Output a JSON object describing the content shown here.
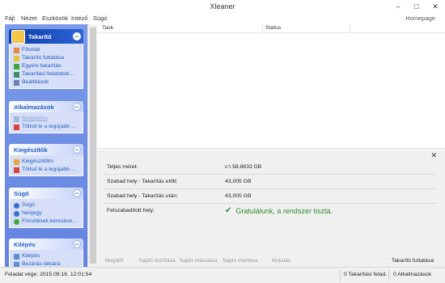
{
  "window": {
    "title": "Xleaner",
    "minimize": "–",
    "maximize": "□",
    "close": "✕"
  },
  "menu": {
    "items": [
      "Fájl",
      "Nézet",
      "Eszközök",
      "Intéző",
      "Súgó"
    ],
    "homepage": "Homepage"
  },
  "sidebar": {
    "takarito": {
      "title": "Takarító",
      "items": [
        "Főoldal",
        "Takarító futtatása",
        "Egyéni takarítás",
        "Takarítási feladatok...",
        "Beállítások"
      ]
    },
    "alkalmazasok": {
      "title": "Alkalmazások",
      "items": [
        "Beépülőim",
        "Töltsd le a legújabb ..."
      ]
    },
    "kiegeszitok": {
      "title": "Kiegészítők",
      "items": [
        "Kiegészítőim",
        "Töltsd le a legújabb ..."
      ]
    },
    "sugo": {
      "title": "Súgó",
      "items": [
        "Súgó",
        "Névjegy",
        "Frissítések keresése..."
      ]
    },
    "kilepes": {
      "title": "Kilépés",
      "items": [
        "Kilépés",
        "Bezárás tálcára"
      ]
    }
  },
  "tasktable": {
    "col_task": "Task",
    "col_status": "Status"
  },
  "summary": {
    "close": "✕",
    "rows": [
      {
        "label": "Teljes méret:",
        "value": "c:\\ 58,8633 GB"
      },
      {
        "label": "Szabad hely - Takarítás előtt:",
        "value": "43,005 GB"
      },
      {
        "label": "Szabad hely - Takarítás után:",
        "value": "43,005 GB"
      },
      {
        "label": "Felszabadított hely:",
        "value": ""
      }
    ],
    "congrats": "Gratulálunk, a rendszer tiszta.",
    "check": "✔"
  },
  "bottombar": {
    "actions": [
      "Megállít",
      "Napló tisztítása",
      "Napló másolása",
      "Napló mentése",
      "Mutatás"
    ],
    "start": "Takarító futtatása"
  },
  "statusbar": {
    "last_task": "Feladat vége: 2015.09.16. 12:01:54",
    "tasks": "0 Takarítási felad.",
    "apps": "0 Alkalmazások"
  },
  "colors": {
    "sidebar": "#6383e0",
    "link": "#215dc6",
    "success": "#2e8b2e"
  }
}
